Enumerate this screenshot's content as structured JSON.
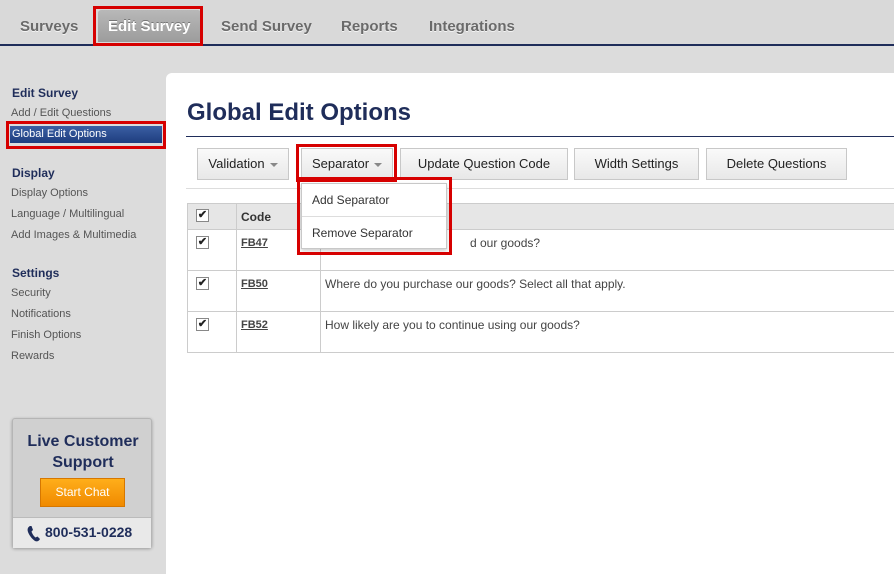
{
  "nav": {
    "tabs": [
      "Surveys",
      "Edit Survey",
      "Send Survey",
      "Reports",
      "Integrations"
    ],
    "active_tab": "Edit Survey"
  },
  "sidebar": {
    "edit_survey_heading": "Edit Survey",
    "edit_survey_items": [
      "Add / Edit Questions",
      "Global Edit Options"
    ],
    "display_heading": "Display",
    "display_items": [
      "Display Options",
      "Language / Multilingual",
      "Add Images & Multimedia"
    ],
    "settings_heading": "Settings",
    "settings_items": [
      "Security",
      "Notifications",
      "Finish Options",
      "Rewards"
    ],
    "active_item": "Global Edit Options"
  },
  "support": {
    "title": "Live Customer Support",
    "chat_button": "Start Chat",
    "phone": "800-531-0228",
    "icons": {
      "phone": "phone-icon"
    }
  },
  "main": {
    "title": "Global Edit Options",
    "toolbar": {
      "validation": "Validation",
      "separator": "Separator",
      "update_code": "Update Question Code",
      "width_settings": "Width Settings",
      "delete_questions": "Delete Questions"
    },
    "separator_menu": [
      "Add Separator",
      "Remove Separator"
    ],
    "table": {
      "code_header": "Code",
      "rows": [
        {
          "code": "FB47",
          "question": "d our goods?",
          "checked": true
        },
        {
          "code": "FB50",
          "question": "Where do you purchase our goods? Select all that apply.",
          "checked": true
        },
        {
          "code": "FB52",
          "question": "How likely are you to continue using our goods?",
          "checked": true
        }
      ]
    }
  },
  "colors": {
    "navy": "#1f2d5a",
    "highlight": "#d60000",
    "chat_orange": "#f08a00",
    "active_sidebar": "#1e3d7f"
  }
}
